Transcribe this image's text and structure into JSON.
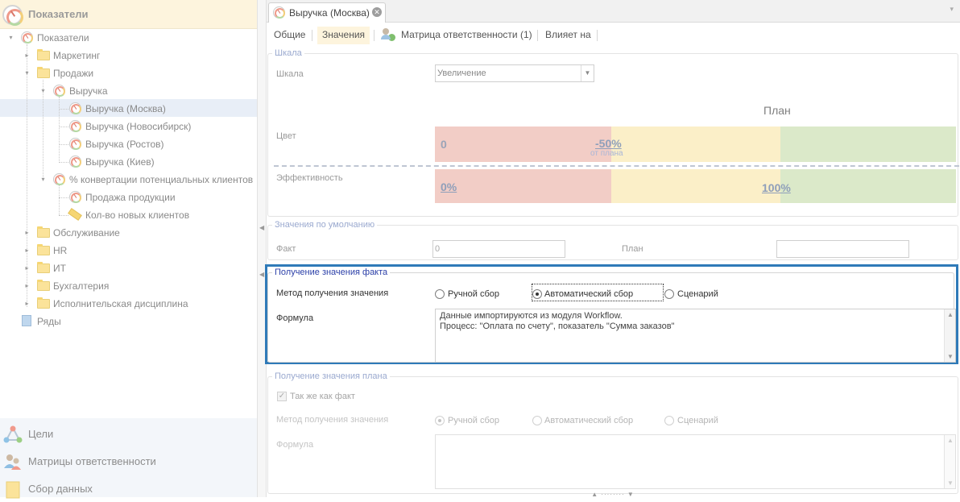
{
  "left_panel": {
    "header_title": "Показатели",
    "tree": [
      {
        "label": "Показатели",
        "icon": "gauge-icon"
      },
      {
        "label": "Маркетинг",
        "icon": "folder-icon"
      },
      {
        "label": "Продажи",
        "icon": "folder-icon"
      },
      {
        "label": "Выручка",
        "icon": "gauge-icon"
      },
      {
        "label": "Выручка (Москва)",
        "icon": "gauge-icon"
      },
      {
        "label": "Выручка (Новосибирск)",
        "icon": "gauge-icon"
      },
      {
        "label": "Выручка (Ростов)",
        "icon": "gauge-icon"
      },
      {
        "label": "Выручка (Киев)",
        "icon": "gauge-icon"
      },
      {
        "label": "% конвертации потенциальных клиентов",
        "icon": "gauge-icon"
      },
      {
        "label": "Продажа продукции",
        "icon": "gauge-icon"
      },
      {
        "label": "Кол-во новых клиентов",
        "icon": "ruler-icon"
      },
      {
        "label": "Обслуживание",
        "icon": "folder-icon"
      },
      {
        "label": "HR",
        "icon": "folder-icon"
      },
      {
        "label": "ИТ",
        "icon": "folder-icon"
      },
      {
        "label": "Бухгалтерия",
        "icon": "folder-icon"
      },
      {
        "label": "Исполнительская дисциплина",
        "icon": "folder-icon"
      },
      {
        "label": "Ряды",
        "icon": "series-icon"
      }
    ],
    "selected_index": 4,
    "nav": [
      {
        "label": "Цели",
        "icon": "goals-icon"
      },
      {
        "label": "Матрицы ответственности",
        "icon": "users-icon"
      },
      {
        "label": "Сбор данных",
        "icon": "data-collection-icon"
      }
    ]
  },
  "document_tab": {
    "label": "Выручка (Москва)"
  },
  "subtabs": {
    "general": "Общие",
    "values": "Значения",
    "matrix": "Матрица ответственности (1)",
    "affects": "Влияет на"
  },
  "scale_group": {
    "legend": "Шкала",
    "scale_label": "Шкала",
    "scale_value": "Увеличение",
    "plan_label": "План",
    "color_label": "Цвет",
    "color_zero": "0",
    "color_threshold": "-50%",
    "color_threshold_sub": "от плана",
    "efficiency_label": "Эффективность",
    "eff_low": "0%",
    "eff_high": "100%"
  },
  "defaults_group": {
    "legend": "Значения по умолчанию",
    "fact_label": "Факт",
    "fact_value": "0",
    "plan_label": "План",
    "plan_value": ""
  },
  "fact_group": {
    "legend": "Получение значения факта",
    "method_label": "Метод получения значения",
    "options": [
      "Ручной сбор",
      "Автоматический сбор",
      "Сценарий"
    ],
    "selected": "Автоматический сбор",
    "formula_label": "Формула",
    "formula_lines": [
      "Данные импортируются из модуля Workflow.",
      "Процесс: \"Оплата по счету\", показатель \"Сумма заказов\""
    ]
  },
  "plan_group": {
    "legend": "Получение значения плана",
    "same_as_fact": "Так же как факт",
    "same_as_fact_checked": true,
    "method_label": "Метод получения значения",
    "options": [
      "Ручной сбор",
      "Автоматический сбор",
      "Сценарий"
    ],
    "selected": "Ручной сбор",
    "formula_label": "Формула"
  },
  "colors": {
    "highlight_border": "#2f7ab8",
    "red_zone": "#f2cdc6",
    "yellow_zone": "#fbefc8",
    "green_zone": "#dbe9c9",
    "header_bg": "#fdf4dd"
  }
}
